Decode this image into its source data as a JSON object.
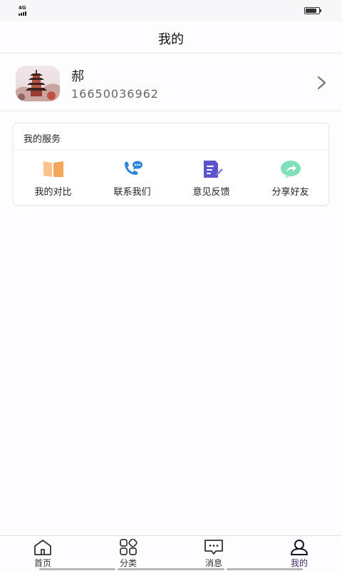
{
  "status_bar": {
    "network": "4G",
    "battery_level": 0.85
  },
  "header": {
    "title": "我的"
  },
  "profile": {
    "name": "郝",
    "phone": "16650036962"
  },
  "services": {
    "title": "我的服务",
    "items": [
      {
        "label": "我的对比",
        "icon": "compare-icon",
        "color": "#f4a75a"
      },
      {
        "label": "联系我们",
        "icon": "phone-chat-icon",
        "color": "#2f86d8"
      },
      {
        "label": "意见反馈",
        "icon": "feedback-edit-icon",
        "color": "#5b55c9"
      },
      {
        "label": "分享好友",
        "icon": "share-icon",
        "color": "#62d3a6"
      }
    ]
  },
  "bottom_nav": {
    "items": [
      {
        "label": "首页",
        "icon": "home-icon"
      },
      {
        "label": "分类",
        "icon": "category-grid-icon"
      },
      {
        "label": "消息",
        "icon": "message-icon"
      },
      {
        "label": "我的",
        "icon": "profile-icon"
      }
    ],
    "active": "我的",
    "active_color": "#4a2a6a"
  }
}
